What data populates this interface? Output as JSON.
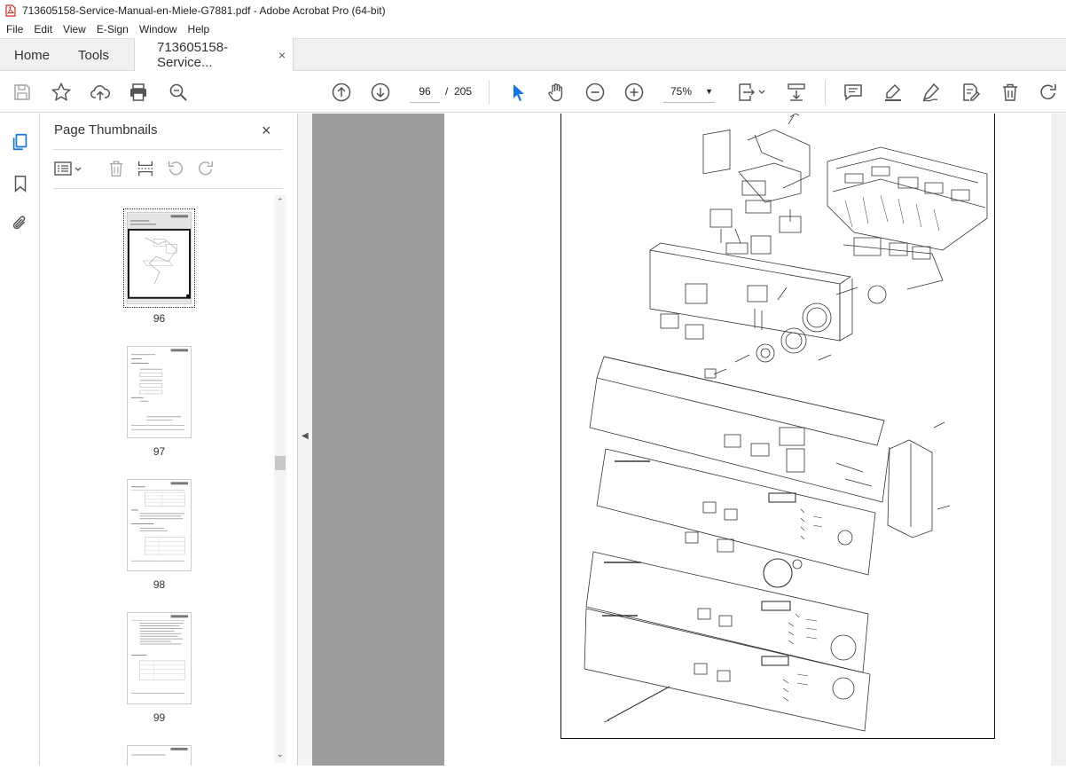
{
  "window": {
    "title": "713605158-Service-Manual-en-Miele-G7881.pdf - Adobe Acrobat Pro (64-bit)"
  },
  "menu": [
    "File",
    "Edit",
    "View",
    "E-Sign",
    "Window",
    "Help"
  ],
  "tabs": {
    "home": "Home",
    "tools": "Tools",
    "document": "713605158-Service...",
    "close_glyph": "×"
  },
  "toolbar": {
    "current_page": "96",
    "page_separator": "/",
    "total_pages": "205",
    "zoom": "75%",
    "icons": [
      "save-icon",
      "star-icon",
      "upload-icon",
      "print-icon",
      "find-icon",
      "prev-page-icon",
      "next-page-icon",
      "select-cursor-icon",
      "hand-icon",
      "zoom-out-icon",
      "zoom-in-icon",
      "page-fit-icon",
      "scroll-mode-icon",
      "comment-icon",
      "highlight-icon",
      "draw-icon",
      "fill-sign-icon",
      "delete-icon",
      "rotate-icon"
    ]
  },
  "thumbnails_panel": {
    "title": "Page Thumbnails",
    "close_glyph": "×",
    "pages": [
      {
        "number": "96",
        "selected": true
      },
      {
        "number": "97",
        "selected": false
      },
      {
        "number": "98",
        "selected": false
      },
      {
        "number": "99",
        "selected": false
      }
    ]
  },
  "colors": {
    "doc_background": "#9c9c9c",
    "chrome": "#f0f0f0",
    "accent": "#1473e6",
    "pdf_red": "#d7261e"
  }
}
